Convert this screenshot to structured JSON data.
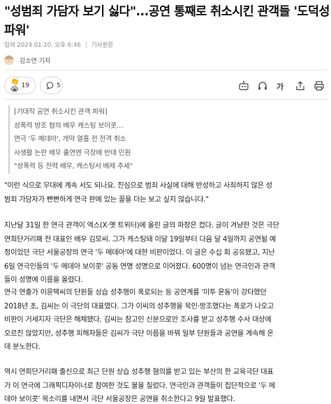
{
  "article": {
    "headline": "\"성범죄 가담자 보기 싫다\"...공연 통째로 취소시킨 관객들 '도덕성 파워'",
    "meta": {
      "published": "입력 2024.01.10. 오후 6:46",
      "source_label": "기사원문"
    },
    "reporter": "김소연 기자",
    "actions": {
      "reaction_emoji": "👏😭",
      "reaction_count": "19",
      "comment_count": "5"
    },
    "subheads": [
      "[기대작 공연 취소시킨 관객 파워]",
      "성폭력 방조 혐의 배우 캐스팅 보이콧…",
      "연극 '두 메데아', 개막 열흘 전 전격 취소",
      "사생활 논란 배우 출연엔 극장에 반대 민원",
      "\"성폭력 등 전력 배우, 캐스팅서 배제 추세\""
    ],
    "paragraphs": [
      [
        "\"이런 식으로 무대에 계속 서도 되나요. 진심으로 범죄 사실에 대해 반성하고 사죄하지 않은 성",
        "범죄 가담자가 뻔뻔하게 연극 판에 있는 꼴을 더는 보고 싶지 않습니다.\""
      ],
      [
        "지난달 31일 한 연극 관객이 엑스(X·옛 트위터)에 올린 글의 파장은 컸다. 글이 겨냥한 것은 극단",
        "연희단거리패 전 대표인 배우 김모씨. 그가 캐스팅돼 이달 19일부터 다음 달 4일까지 공연될 예",
        "정이었던 극단 서울공장의 연극 '두 메데아'에 대한 비판이었다. 이 글은 수십 회 공유됐고, 지난",
        "6일 연극인들의 '두 메데아 보이콧' 공동 연명 성명으로 이어졌다. 600명이 넘는 연극인과 관객",
        "들이 성명에 이름을 올렸다."
      ],
      [
        "연극 연출가 이윤택씨의 단원들 상습 성추행이 폭로되는 등 공연계를 '미투 운동'이 강타했던",
        "2018년 초, 김씨는 이 극단의 대표였다. 그가 이씨의 성추행을 묵인·방조했다는 폭로가 나오고",
        "비판이 거세지자 극단은 해체됐다. 김씨는 참고인 신분으로만 조사를 받고 성추행 수사 대상에",
        "오르진 않았지만, 성추행 피해자들은 김씨가 극단 이름을 바꿔 일부 단원들과 공연을 계속해 온",
        "데 분노한다."
      ],
      [
        "역시 연희단거리패 출신으로 최근 단원 상습 성추행 혐의를 받고 있는 부산의 한 교육극단 대표",
        "가 이 연극에 그래픽디자이너로 참여한 것도 불을 질렀다. 연극인과 관객들이 집단적으로 '두 메",
        "데아 보이콧' 목소리를 내면서 극단 서울공장은 공연을 취소한다고 9일 발표했다."
      ]
    ]
  }
}
